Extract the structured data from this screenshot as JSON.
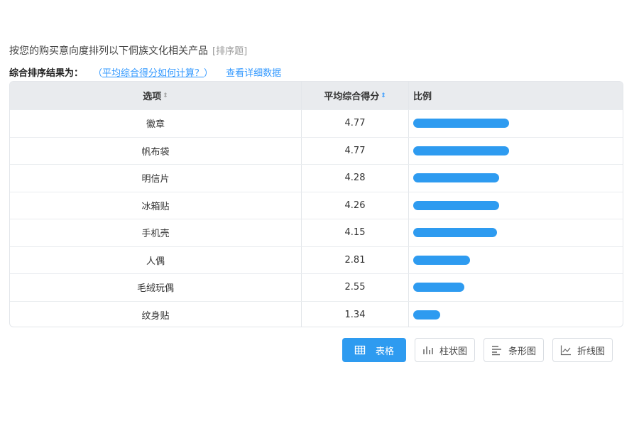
{
  "question": {
    "text": "按您的购买意向度排列以下侗族文化相关产品",
    "type": "[排序题]"
  },
  "summary": {
    "label": "综合排序结果为：",
    "paren_open": "（",
    "link": "平均综合得分如何计算？",
    "paren_close": "）",
    "detail_link": "查看详细数据"
  },
  "table": {
    "headers": {
      "option": "选项",
      "score": "平均综合得分",
      "ratio": "比例"
    },
    "sort_glyph": "⇕"
  },
  "chart_data": {
    "type": "bar",
    "categories": [
      "徽章",
      "帆布袋",
      "明信片",
      "冰箱贴",
      "手机壳",
      "人偶",
      "毛绒玩偶",
      "纹身贴"
    ],
    "values": [
      4.77,
      4.77,
      4.28,
      4.26,
      4.15,
      2.81,
      2.55,
      1.34
    ],
    "value_labels": [
      "4.77",
      "4.77",
      "4.28",
      "4.26",
      "4.15",
      "2.81",
      "2.55",
      "1.34"
    ],
    "xlabel": "",
    "ylabel": "",
    "xlim": [
      0,
      6
    ],
    "bar_color": "#2e9bf0"
  },
  "view_buttons": [
    {
      "label": "表格",
      "icon": "table-icon",
      "active": true
    },
    {
      "label": "柱状图",
      "icon": "column-chart-icon",
      "active": false
    },
    {
      "label": "条形图",
      "icon": "bar-chart-icon",
      "active": false
    },
    {
      "label": "折线图",
      "icon": "line-chart-icon",
      "active": false
    }
  ]
}
